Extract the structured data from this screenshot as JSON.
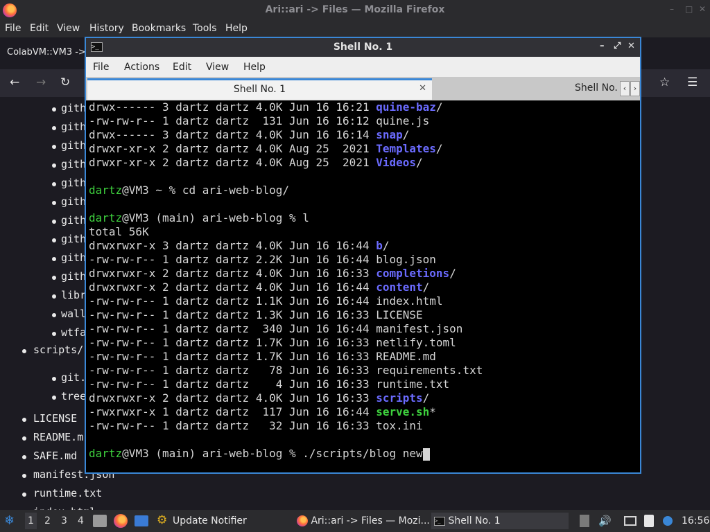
{
  "firefox": {
    "window_title": "Ari::ari -> Files — Mozilla Firefox",
    "menu": [
      "File",
      "Edit",
      "View",
      "History",
      "Bookmarks",
      "Tools",
      "Help"
    ],
    "tab_label": "ColabVM::VM3 ->",
    "nav": {
      "back": "←",
      "forward": "→",
      "reload": "↻",
      "star": "☆",
      "menu": "☰"
    }
  },
  "page": {
    "nested_items": [
      "gith",
      "gith",
      "gith",
      "gith",
      "gith",
      "gith",
      "gith",
      "gith",
      "gith",
      "gith",
      "libr",
      "wall",
      "wtfa"
    ],
    "scripts_item": "scripts/",
    "scripts_children": [
      "git.",
      "tree"
    ],
    "root_items": [
      "LICENSE",
      "README.m",
      "SAFE.md",
      "manifest.json",
      "runtime.txt",
      "index.html"
    ]
  },
  "shell": {
    "window_title": "Shell No. 1",
    "menu": [
      "File",
      "Actions",
      "Edit",
      "View",
      "Help"
    ],
    "tabs": [
      "Shell No. 1",
      "Shell No."
    ],
    "lines": [
      {
        "text": "drwx------ 3 dartz dartz 4.0K Jun 16 16:21 ",
        "name": "quine-baz",
        "kind": "dir",
        "suffix": "/"
      },
      {
        "text": "-rw-rw-r-- 1 dartz dartz  131 Jun 16 16:12 quine.js"
      },
      {
        "text": "drwx------ 3 dartz dartz 4.0K Jun 16 16:14 ",
        "name": "snap",
        "kind": "dir",
        "suffix": "/"
      },
      {
        "text": "drwxr-xr-x 2 dartz dartz 4.0K Aug 25  2021 ",
        "name": "Templates",
        "kind": "dir",
        "suffix": "/"
      },
      {
        "text": "drwxr-xr-x 2 dartz dartz 4.0K Aug 25  2021 ",
        "name": "Videos",
        "kind": "dir",
        "suffix": "/"
      },
      {
        "text": ""
      },
      {
        "prompt": "dartz",
        "text": "@VM3 ~ % cd ari-web-blog/"
      },
      {
        "text": ""
      },
      {
        "prompt": "dartz",
        "text": "@VM3 (main) ari-web-blog % l"
      },
      {
        "text": "total 56K"
      },
      {
        "text": "drwxrwxr-x 3 dartz dartz 4.0K Jun 16 16:44 ",
        "name": "b",
        "kind": "dir",
        "suffix": "/"
      },
      {
        "text": "-rw-rw-r-- 1 dartz dartz 2.2K Jun 16 16:44 blog.json"
      },
      {
        "text": "drwxrwxr-x 2 dartz dartz 4.0K Jun 16 16:33 ",
        "name": "completions",
        "kind": "dir",
        "suffix": "/"
      },
      {
        "text": "drwxrwxr-x 2 dartz dartz 4.0K Jun 16 16:44 ",
        "name": "content",
        "kind": "dir",
        "suffix": "/"
      },
      {
        "text": "-rw-rw-r-- 1 dartz dartz 1.1K Jun 16 16:44 index.html"
      },
      {
        "text": "-rw-rw-r-- 1 dartz dartz 1.3K Jun 16 16:33 LICENSE"
      },
      {
        "text": "-rw-rw-r-- 1 dartz dartz  340 Jun 16 16:44 manifest.json"
      },
      {
        "text": "-rw-rw-r-- 1 dartz dartz 1.7K Jun 16 16:33 netlify.toml"
      },
      {
        "text": "-rw-rw-r-- 1 dartz dartz 1.7K Jun 16 16:33 README.md"
      },
      {
        "text": "-rw-rw-r-- 1 dartz dartz   78 Jun 16 16:33 requirements.txt"
      },
      {
        "text": "-rw-rw-r-- 1 dartz dartz    4 Jun 16 16:33 runtime.txt"
      },
      {
        "text": "drwxrwxr-x 2 dartz dartz 4.0K Jun 16 16:33 ",
        "name": "scripts",
        "kind": "dir",
        "suffix": "/"
      },
      {
        "text": "-rwxrwxr-x 1 dartz dartz  117 Jun 16 16:44 ",
        "name": "serve.sh",
        "kind": "exe",
        "suffix": "*"
      },
      {
        "text": "-rw-rw-r-- 1 dartz dartz   32 Jun 16 16:33 tox.ini"
      },
      {
        "text": ""
      },
      {
        "prompt": "dartz",
        "text": "@VM3 (main) ari-web-blog % ./scripts/blog new",
        "cursor": true
      }
    ]
  },
  "taskbar": {
    "workspaces": [
      "1",
      "2",
      "3",
      "4"
    ],
    "update_notifier": "Update Notifier",
    "task_firefox": "Ari::ari -> Files — Mozi...",
    "task_shell": "Shell No. 1",
    "clock": "16:56"
  },
  "colors": {
    "dir": "#6b6bff",
    "exe": "#3ed13e",
    "accent": "#3a87d6"
  }
}
